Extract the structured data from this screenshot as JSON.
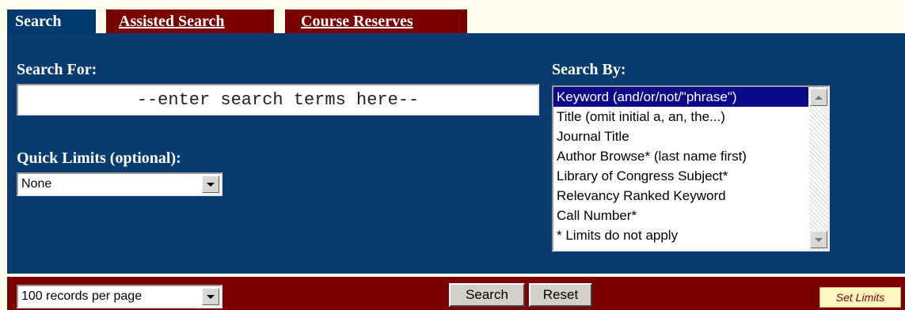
{
  "tabs": [
    {
      "label": "Search",
      "active": true
    },
    {
      "label": "Assisted Search",
      "active": false
    },
    {
      "label": "Course Reserves",
      "active": false
    }
  ],
  "search": {
    "label": "Search For:",
    "placeholder": "--enter search terms here--",
    "value": ""
  },
  "quick_limits": {
    "label": "Quick Limits (optional):",
    "selected": "None"
  },
  "search_by": {
    "label": "Search By:",
    "options": [
      "Keyword (and/or/not/\"phrase\")",
      "Title (omit initial a, an, the...)",
      "Journal Title",
      "Author Browse* (last name first)",
      "Library of Congress Subject*",
      "Relevancy Ranked Keyword",
      "Call Number*",
      "* Limits do not apply"
    ],
    "selected_index": 0
  },
  "bottom": {
    "records_per_page": "100 records per page",
    "search_button": "Search",
    "reset_button": "Reset",
    "set_limits": "Set Limits"
  },
  "colors": {
    "panel": "#0a3b6e",
    "maroon": "#7b0000",
    "cream": "#fefcea",
    "selection": "#0a0a8a"
  }
}
